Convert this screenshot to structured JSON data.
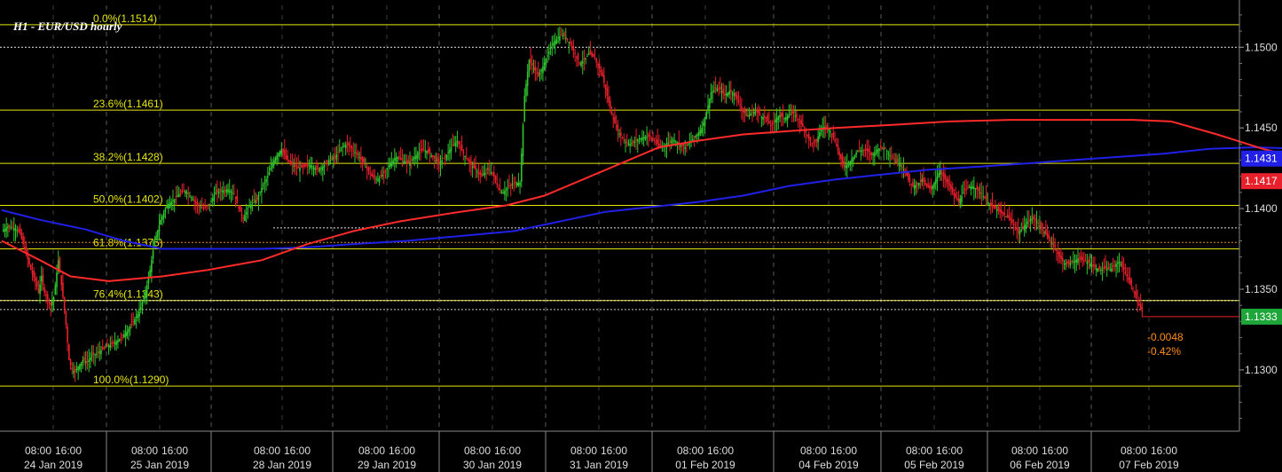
{
  "chart_data": {
    "type": "candlestick",
    "title": "H1 - EUR/USD hourly",
    "ylim": [
      1.1262,
      1.1526
    ],
    "y_ticks": [
      "1.1300",
      "1.1350",
      "1.1400",
      "1.1450",
      "1.1500"
    ],
    "x_time_labels": [
      "08:00",
      "16:00"
    ],
    "day_labels": [
      "24 Jan 2019",
      "25 Jan 2019",
      "28 Jan 2019",
      "29 Jan 2019",
      "30 Jan 2019",
      "31 Jan 2019",
      "01 Feb 2019",
      "04 Feb 2019",
      "05 Feb 2019",
      "06 Feb 2019",
      "07 Feb 2019"
    ],
    "fibonacci": [
      {
        "label": "0.0%(1.1514)",
        "value": 1.1514
      },
      {
        "label": "23.6%(1.1461)",
        "value": 1.1461
      },
      {
        "label": "38.2%(1.1428)",
        "value": 1.1428
      },
      {
        "label": "50.0%(1.1402)",
        "value": 1.1402
      },
      {
        "label": "61.8%(1.1375)",
        "value": 1.1375
      },
      {
        "label": "76.4%(1.1343)",
        "value": 1.1343
      },
      {
        "label": "100.0%(1.1290)",
        "value": 1.129
      }
    ],
    "ref_levels": [
      1.15,
      1.1388,
      1.1379,
      1.1343,
      1.1333
    ],
    "last_price": {
      "label": "1.1333",
      "value": 1.1333
    },
    "ma_blue_tag": {
      "label": "1.1431",
      "value": 1.1431
    },
    "ma_red_tag": {
      "label": "1.1417",
      "value": 1.1417
    },
    "change_abs": "-0.0048",
    "change_pct": "-0.42%",
    "colors": {
      "up": "#2ec52e",
      "down": "#e8202b",
      "ma_blue": "#2020e8",
      "ma_red": "#ff2a2a",
      "fib": "#e6e60a",
      "ref": "#ffffff",
      "bg": "#000000",
      "grid": "#5a5a5a",
      "axis_text": "#dddddd",
      "change": "#ff8c1a"
    },
    "ma_red": [
      [
        0,
        1.138
      ],
      [
        25,
        1.1368
      ],
      [
        45,
        1.1358
      ],
      [
        70,
        1.1355
      ],
      [
        105,
        1.1358
      ],
      [
        135,
        1.1362
      ],
      [
        170,
        1.1368
      ],
      [
        200,
        1.1378
      ],
      [
        230,
        1.1386
      ],
      [
        260,
        1.1392
      ],
      [
        300,
        1.1398
      ],
      [
        330,
        1.1402
      ],
      [
        355,
        1.1408
      ],
      [
        380,
        1.1418
      ],
      [
        405,
        1.1428
      ],
      [
        430,
        1.1438
      ],
      [
        455,
        1.1442
      ],
      [
        485,
        1.1446
      ],
      [
        515,
        1.1448
      ],
      [
        545,
        1.145
      ],
      [
        585,
        1.1452
      ],
      [
        620,
        1.1454
      ],
      [
        660,
        1.1455
      ],
      [
        700,
        1.1455
      ],
      [
        740,
        1.1455
      ],
      [
        765,
        1.1454
      ],
      [
        795,
        1.1446
      ],
      [
        825,
        1.1437
      ],
      [
        855,
        1.143
      ],
      [
        885,
        1.1424
      ],
      [
        902,
        1.1419
      ]
    ],
    "ma_blue": [
      [
        0,
        1.1399
      ],
      [
        25,
        1.1393
      ],
      [
        55,
        1.1387
      ],
      [
        80,
        1.138
      ],
      [
        105,
        1.1375
      ],
      [
        135,
        1.1375
      ],
      [
        170,
        1.1375
      ],
      [
        200,
        1.1376
      ],
      [
        230,
        1.1378
      ],
      [
        265,
        1.138
      ],
      [
        300,
        1.1383
      ],
      [
        335,
        1.1386
      ],
      [
        365,
        1.1392
      ],
      [
        395,
        1.1398
      ],
      [
        425,
        1.1401
      ],
      [
        455,
        1.1404
      ],
      [
        485,
        1.1408
      ],
      [
        515,
        1.1414
      ],
      [
        545,
        1.1418
      ],
      [
        575,
        1.1421
      ],
      [
        605,
        1.1424
      ],
      [
        640,
        1.1426
      ],
      [
        670,
        1.1428
      ],
      [
        700,
        1.143
      ],
      [
        730,
        1.1432
      ],
      [
        760,
        1.1434
      ],
      [
        790,
        1.1437
      ],
      [
        820,
        1.1438
      ],
      [
        850,
        1.1437
      ],
      [
        880,
        1.1435
      ],
      [
        903,
        1.1431
      ]
    ],
    "price_path": [
      [
        0,
        1.1386
      ],
      [
        4,
        1.1389
      ],
      [
        8,
        1.1388
      ],
      [
        12,
        1.1385
      ],
      [
        14,
        1.1378
      ],
      [
        16,
        1.1372
      ],
      [
        19,
        1.1362
      ],
      [
        22,
        1.1355
      ],
      [
        24,
        1.1348
      ],
      [
        26,
        1.1358
      ],
      [
        28,
        1.1348
      ],
      [
        30,
        1.1344
      ],
      [
        32,
        1.134
      ],
      [
        34,
        1.1345
      ],
      [
        37,
        1.1368
      ],
      [
        40,
        1.1345
      ],
      [
        42,
        1.1328
      ],
      [
        44,
        1.1306
      ],
      [
        46,
        1.13
      ],
      [
        48,
        1.1299
      ],
      [
        50,
        1.1302
      ],
      [
        53,
        1.1306
      ],
      [
        56,
        1.1305
      ],
      [
        59,
        1.1309
      ],
      [
        62,
        1.131
      ],
      [
        66,
        1.1313
      ],
      [
        70,
        1.1315
      ],
      [
        74,
        1.1317
      ],
      [
        78,
        1.132
      ],
      [
        82,
        1.1324
      ],
      [
        86,
        1.133
      ],
      [
        90,
        1.1336
      ],
      [
        94,
        1.1348
      ],
      [
        97,
        1.1362
      ],
      [
        100,
        1.138
      ],
      [
        104,
        1.1393
      ],
      [
        108,
        1.1402
      ],
      [
        112,
        1.1405
      ],
      [
        116,
        1.1409
      ],
      [
        120,
        1.1411
      ],
      [
        124,
        1.1407
      ],
      [
        128,
        1.1402
      ],
      [
        132,
        1.14
      ],
      [
        136,
        1.1403
      ],
      [
        140,
        1.141
      ],
      [
        144,
        1.1411
      ],
      [
        148,
        1.1412
      ],
      [
        152,
        1.1409
      ],
      [
        155,
        1.14
      ],
      [
        158,
        1.1394
      ],
      [
        161,
        1.14
      ],
      [
        164,
        1.1404
      ],
      [
        167,
        1.1406
      ],
      [
        170,
        1.1413
      ],
      [
        174,
        1.142
      ],
      [
        177,
        1.1428
      ],
      [
        180,
        1.1433
      ],
      [
        183,
        1.1437
      ],
      [
        186,
        1.1431
      ],
      [
        190,
        1.1427
      ],
      [
        194,
        1.1425
      ],
      [
        198,
        1.1426
      ],
      [
        202,
        1.1427
      ],
      [
        206,
        1.1424
      ],
      [
        210,
        1.1426
      ],
      [
        214,
        1.143
      ],
      [
        218,
        1.1432
      ],
      [
        222,
        1.1438
      ],
      [
        226,
        1.144
      ],
      [
        230,
        1.1436
      ],
      [
        234,
        1.1432
      ],
      [
        238,
        1.1426
      ],
      [
        242,
        1.142
      ],
      [
        246,
        1.1418
      ],
      [
        250,
        1.1422
      ],
      [
        254,
        1.1428
      ],
      [
        258,
        1.1432
      ],
      [
        262,
        1.143
      ],
      [
        266,
        1.1428
      ],
      [
        270,
        1.1432
      ],
      [
        274,
        1.1436
      ],
      [
        278,
        1.1436
      ],
      [
        282,
        1.1432
      ],
      [
        286,
        1.1428
      ],
      [
        290,
        1.1432
      ],
      [
        294,
        1.1438
      ],
      [
        298,
        1.1442
      ],
      [
        302,
        1.1434
      ],
      [
        306,
        1.1428
      ],
      [
        310,
        1.1424
      ],
      [
        314,
        1.142
      ],
      [
        318,
        1.1425
      ],
      [
        322,
        1.142
      ],
      [
        325,
        1.1412
      ],
      [
        328,
        1.141
      ],
      [
        332,
        1.1414
      ],
      [
        336,
        1.1416
      ],
      [
        339,
        1.1416
      ],
      [
        342,
        1.147
      ],
      [
        345,
        1.1492
      ],
      [
        348,
        1.1487
      ],
      [
        351,
        1.1482
      ],
      [
        354,
        1.1488
      ],
      [
        357,
        1.1495
      ],
      [
        360,
        1.1502
      ],
      [
        363,
        1.1505
      ],
      [
        366,
        1.1508
      ],
      [
        369,
        1.1506
      ],
      [
        372,
        1.1502
      ],
      [
        375,
        1.1496
      ],
      [
        378,
        1.149
      ],
      [
        381,
        1.1492
      ],
      [
        384,
        1.1496
      ],
      [
        387,
        1.1494
      ],
      [
        390,
        1.1489
      ],
      [
        393,
        1.1482
      ],
      [
        396,
        1.147
      ],
      [
        399,
        1.1458
      ],
      [
        403,
        1.1448
      ],
      [
        407,
        1.1442
      ],
      [
        411,
        1.144
      ],
      [
        415,
        1.1442
      ],
      [
        419,
        1.1444
      ],
      [
        423,
        1.1445
      ],
      [
        427,
        1.1442
      ],
      [
        431,
        1.1438
      ],
      [
        435,
        1.144
      ],
      [
        439,
        1.1443
      ],
      [
        443,
        1.144
      ],
      [
        447,
        1.1438
      ],
      [
        451,
        1.1442
      ],
      [
        455,
        1.1446
      ],
      [
        458,
        1.145
      ],
      [
        461,
        1.146
      ],
      [
        464,
        1.1472
      ],
      [
        467,
        1.1474
      ],
      [
        470,
        1.1474
      ],
      [
        473,
        1.147
      ],
      [
        476,
        1.1473
      ],
      [
        479,
        1.1471
      ],
      [
        482,
        1.1466
      ],
      [
        485,
        1.146
      ],
      [
        488,
        1.1457
      ],
      [
        491,
        1.146
      ],
      [
        494,
        1.146
      ],
      [
        497,
        1.1457
      ],
      [
        500,
        1.1456
      ],
      [
        503,
        1.1451
      ],
      [
        506,
        1.1455
      ],
      [
        509,
        1.1458
      ],
      [
        512,
        1.1456
      ],
      [
        515,
        1.1458
      ],
      [
        518,
        1.1459
      ],
      [
        521,
        1.1455
      ],
      [
        524,
        1.1451
      ],
      [
        527,
        1.1445
      ],
      [
        530,
        1.144
      ],
      [
        533,
        1.1442
      ],
      [
        536,
        1.145
      ],
      [
        539,
        1.1451
      ],
      [
        542,
        1.1448
      ],
      [
        545,
        1.1442
      ],
      [
        548,
        1.1433
      ],
      [
        551,
        1.1426
      ],
      [
        554,
        1.1428
      ],
      [
        557,
        1.1432
      ],
      [
        560,
        1.1436
      ],
      [
        563,
        1.1436
      ],
      [
        566,
        1.1436
      ],
      [
        569,
        1.1433
      ],
      [
        572,
        1.1436
      ],
      [
        575,
        1.1438
      ],
      [
        578,
        1.1437
      ],
      [
        581,
        1.1433
      ],
      [
        584,
        1.143
      ],
      [
        587,
        1.1428
      ],
      [
        590,
        1.1425
      ],
      [
        593,
        1.1418
      ],
      [
        596,
        1.1414
      ],
      [
        599,
        1.1415
      ],
      [
        602,
        1.1418
      ],
      [
        605,
        1.1414
      ],
      [
        608,
        1.1412
      ],
      [
        611,
        1.1418
      ],
      [
        614,
        1.1424
      ],
      [
        617,
        1.1418
      ],
      [
        620,
        1.1414
      ],
      [
        623,
        1.1408
      ],
      [
        626,
        1.1404
      ],
      [
        629,
        1.141
      ],
      [
        632,
        1.1413
      ],
      [
        635,
        1.1414
      ],
      [
        638,
        1.1412
      ],
      [
        641,
        1.1409
      ],
      [
        644,
        1.1405
      ],
      [
        647,
        1.1402
      ],
      [
        650,
        1.14
      ],
      [
        653,
        1.1398
      ],
      [
        656,
        1.1396
      ],
      [
        659,
        1.1394
      ],
      [
        662,
        1.139
      ],
      [
        665,
        1.1385
      ],
      [
        668,
        1.1388
      ],
      [
        671,
        1.1392
      ],
      [
        674,
        1.1394
      ],
      [
        677,
        1.1392
      ],
      [
        680,
        1.1388
      ],
      [
        683,
        1.1384
      ],
      [
        686,
        1.138
      ],
      [
        689,
        1.1376
      ],
      [
        692,
        1.137
      ],
      [
        695,
        1.1366
      ],
      [
        698,
        1.1366
      ],
      [
        701,
        1.1367
      ],
      [
        704,
        1.1369
      ],
      [
        707,
        1.1368
      ],
      [
        710,
        1.1367
      ],
      [
        713,
        1.1365
      ],
      [
        716,
        1.1363
      ],
      [
        719,
        1.1362
      ],
      [
        722,
        1.1363
      ],
      [
        725,
        1.1362
      ],
      [
        728,
        1.1365
      ],
      [
        731,
        1.1367
      ],
      [
        734,
        1.1362
      ],
      [
        737,
        1.1356
      ],
      [
        740,
        1.135
      ],
      [
        743,
        1.1342
      ],
      [
        746,
        1.1336
      ]
    ]
  },
  "ui": {
    "x_axis_ticks": [
      "08:00 16:00",
      "08:00 16:00",
      "08:00 16:00",
      "08:00 16:00",
      "08:00 16:00",
      "08:00 16:00",
      "08:00 16:00",
      "08:00 16:00",
      "08:00 16:00",
      "08:00 16:00",
      "08:00 16:00"
    ]
  }
}
